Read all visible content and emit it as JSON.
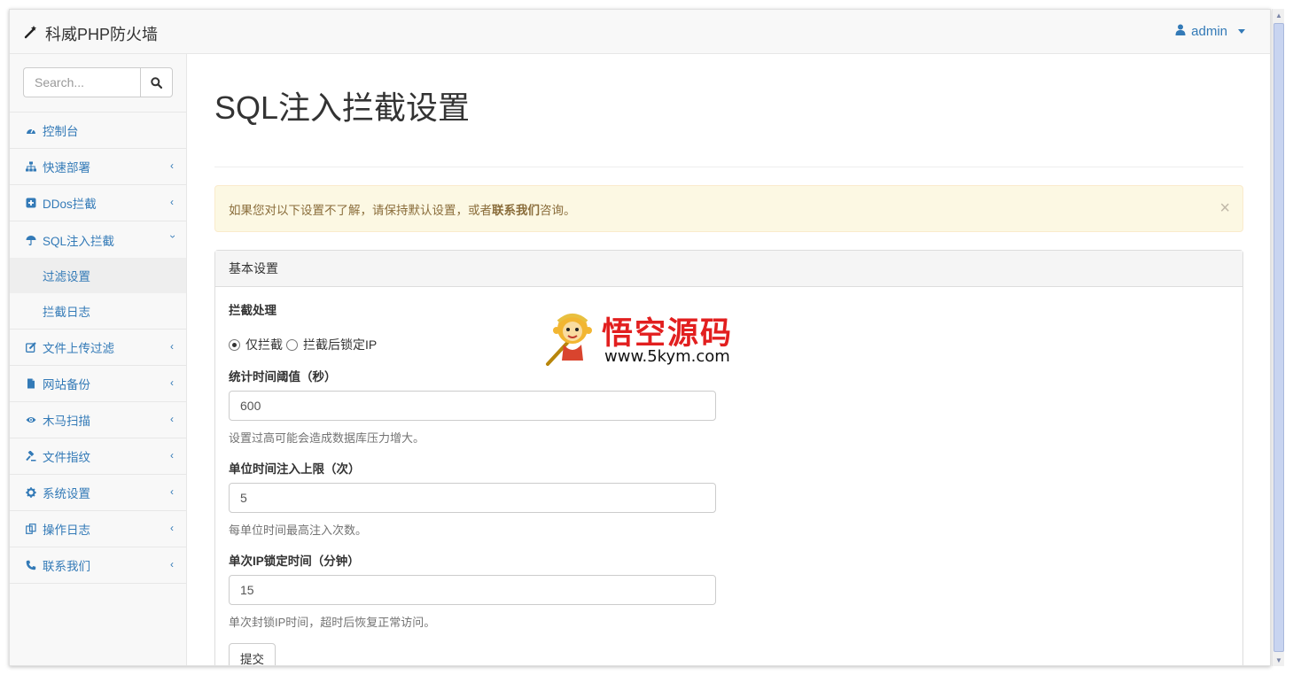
{
  "navbar": {
    "brand": "科威PHP防火墙",
    "brand_icon": "magic-wand-icon",
    "user": "admin",
    "user_icon": "user-icon"
  },
  "sidebar": {
    "search_placeholder": "Search...",
    "items": [
      {
        "label": "控制台",
        "icon": "dashboard-icon",
        "has_arrow": false
      },
      {
        "label": "快速部署",
        "icon": "sitemap-icon",
        "has_arrow": true
      },
      {
        "label": "DDos拦截",
        "icon": "plus-square-icon",
        "has_arrow": true
      },
      {
        "label": "SQL注入拦截",
        "icon": "umbrella-icon",
        "has_arrow": true,
        "expanded": true,
        "children": [
          {
            "label": "过滤设置",
            "active": true
          },
          {
            "label": "拦截日志",
            "active": false
          }
        ]
      },
      {
        "label": "文件上传过滤",
        "icon": "edit-icon",
        "has_arrow": true
      },
      {
        "label": "网站备份",
        "icon": "file-icon",
        "has_arrow": true
      },
      {
        "label": "木马扫描",
        "icon": "eye-icon",
        "has_arrow": true
      },
      {
        "label": "文件指纹",
        "icon": "gavel-icon",
        "has_arrow": true
      },
      {
        "label": "系统设置",
        "icon": "gear-icon",
        "has_arrow": true
      },
      {
        "label": "操作日志",
        "icon": "copy-icon",
        "has_arrow": true
      },
      {
        "label": "联系我们",
        "icon": "phone-icon",
        "has_arrow": true
      }
    ]
  },
  "main": {
    "title": "SQL注入拦截设置",
    "alert": {
      "prefix": "如果您对以下设置不了解，请保持默认设置，或者",
      "link": "联系我们",
      "suffix": "咨询。",
      "close": "×"
    },
    "panel": {
      "heading": "基本设置",
      "action_label": "拦截处理",
      "radio_options": [
        {
          "label": "仅拦截",
          "checked": true
        },
        {
          "label": "拦截后锁定IP",
          "checked": false
        }
      ],
      "fields": [
        {
          "label": "统计时间阈值（秒）",
          "value": "600",
          "help": "设置过高可能会造成数据库压力增大。"
        },
        {
          "label": "单位时间注入上限（次）",
          "value": "5",
          "help": "每单位时间最高注入次数。"
        },
        {
          "label": "单次IP锁定时间（分钟）",
          "value": "15",
          "help": "单次封锁IP时间，超时后恢复正常访问。"
        }
      ],
      "submit": "提交"
    }
  },
  "watermark": {
    "title": "悟空源码",
    "url": "www.5kym.com"
  },
  "colors": {
    "link": "#337ab7",
    "alert_bg": "#fcf8e3",
    "alert_text": "#8a6d3b",
    "watermark_red": "#e21f1f"
  }
}
